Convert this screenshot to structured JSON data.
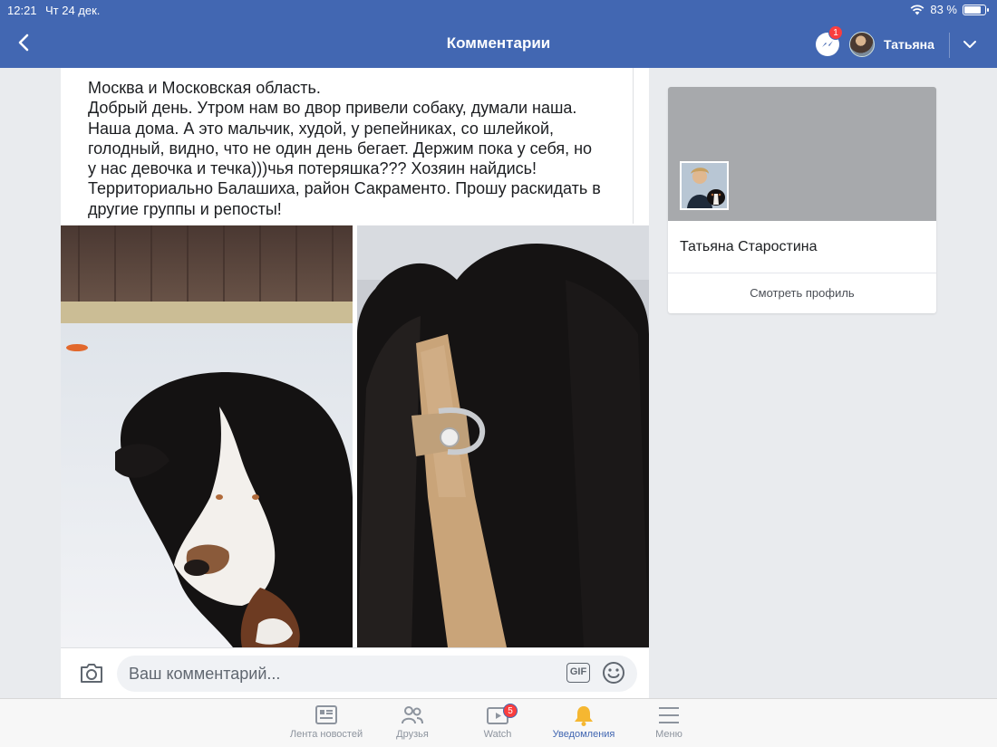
{
  "status_bar": {
    "time": "12:21",
    "date": "Чт 24 дек.",
    "battery": "83 %",
    "battery_level": 0.83
  },
  "nav": {
    "title": "Комментарии",
    "user_name": "Татьяна",
    "messenger_badge": "1"
  },
  "post": {
    "text_lines": [
      "Москва и Московская область.",
      "Добрый день. Утром нам во двор привели собаку, думали наша.",
      "Наша дома. А это мальчик, худой, у репейниках, со шлейкой,",
      "голодный, видно, что не один день бегает. Держим пока у себя, но",
      "у нас девочка и течка)))чья потеряшка??? Хозяин найдись!",
      "Территориально Балашиха, район Сакраменто. Прошу раскидать в",
      "другие группы и репосты!"
    ]
  },
  "comment": {
    "placeholder": "Ваш комментарий...",
    "gif_label": "GIF"
  },
  "profile": {
    "name": "Татьяна Старостина",
    "view_button": "Смотреть профиль"
  },
  "tabs": [
    {
      "label": "Лента новостей",
      "icon": "news-feed-icon"
    },
    {
      "label": "Друзья",
      "icon": "friends-icon"
    },
    {
      "label": "Watch",
      "icon": "watch-icon",
      "badge": "5"
    },
    {
      "label": "Уведомления",
      "icon": "bell-icon",
      "active": true
    },
    {
      "label": "Меню",
      "icon": "menu-icon"
    }
  ],
  "colors": {
    "brand": "#4267b2",
    "badge": "#fa3e3e",
    "background": "#e9ebee"
  }
}
